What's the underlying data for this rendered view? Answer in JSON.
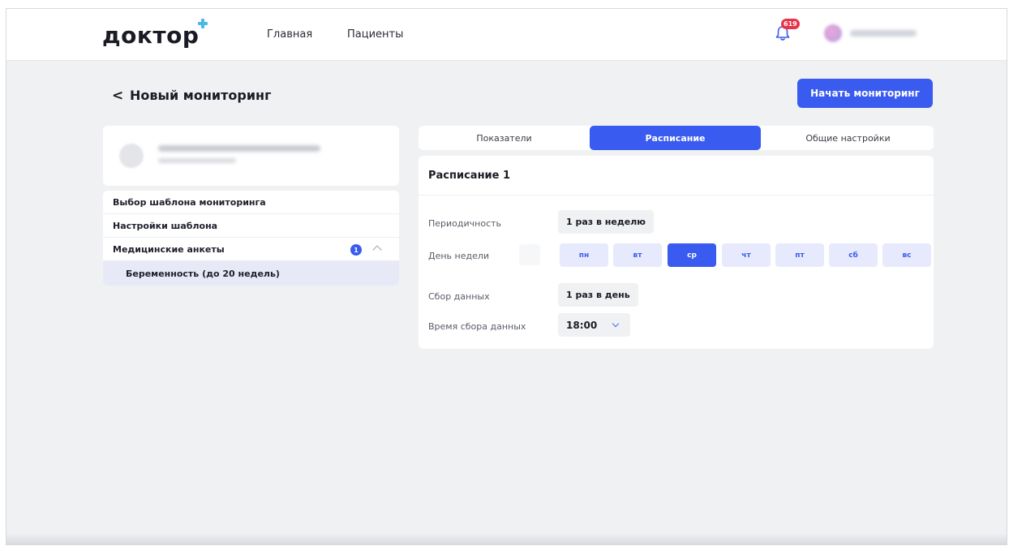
{
  "header": {
    "logo": "доктор",
    "nav": [
      "Главная",
      "Пациенты"
    ],
    "notification_count": "619"
  },
  "page": {
    "back_symbol": "<",
    "title": "Новый мониторинг",
    "primary_button": "Начать мониторинг"
  },
  "sidebar": {
    "items": [
      {
        "label": "Выбор шаблона мониторинга"
      },
      {
        "label": "Настройки шаблона"
      },
      {
        "label": "Медицинские анкеты",
        "count": "1"
      },
      {
        "label": "Беременность (до 20 недель)"
      }
    ]
  },
  "tabs": [
    {
      "label": "Показатели",
      "active": false
    },
    {
      "label": "Расписание",
      "active": true
    },
    {
      "label": "Общие настройки",
      "active": false
    }
  ],
  "schedule": {
    "title": "Расписание 1",
    "periodicity": {
      "label": "Периодичность",
      "value": "1 раз в неделю"
    },
    "weekday": {
      "label": "День недели",
      "days": [
        "пн",
        "вт",
        "ср",
        "чт",
        "пт",
        "сб",
        "вс"
      ],
      "selected": "ср"
    },
    "collection": {
      "label": "Сбор данных",
      "value": "1 раз в день"
    },
    "collection_time": {
      "label": "Время сбора данных",
      "value": "18:00"
    }
  },
  "colors": {
    "accent": "#3a5bef",
    "badge": "#e8334a",
    "background": "#f0f1f3"
  }
}
